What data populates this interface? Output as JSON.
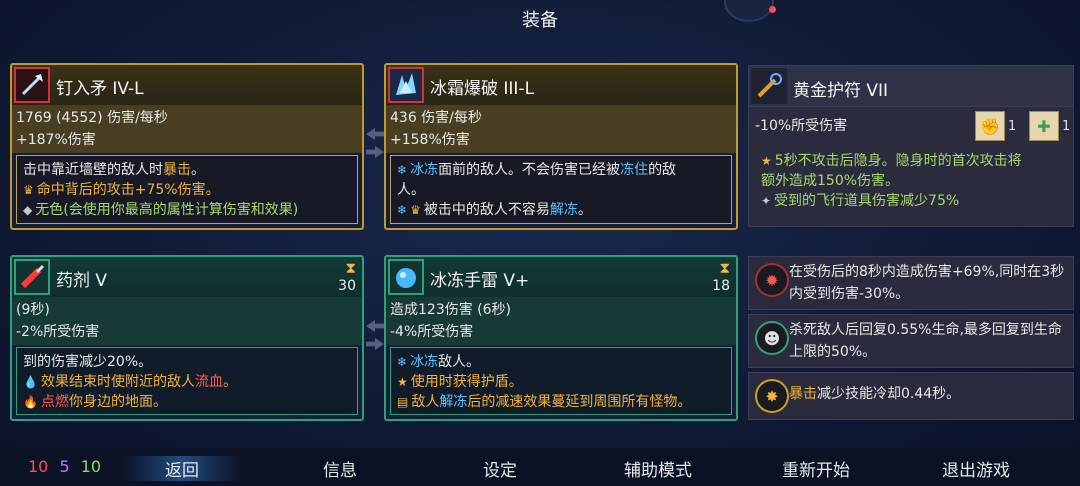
{
  "title": "装备",
  "weapons": [
    {
      "name": "钉入矛 IV-L",
      "stat1": "1769 (4552) 伤害/每秒",
      "stat2": "+187%伤害",
      "desc_line1_pre": "击中靠近墙壁的敌人时",
      "desc_line1_hl": "暴击",
      "desc_line1_post": "。",
      "desc_line2": "命中背后的攻击+75%伤害。",
      "desc_line3": "无色(会使用你最高的属性计算伤害和效果)"
    },
    {
      "name": "冰霜爆破 III-L",
      "stat1": "436 伤害/每秒",
      "stat2": "+158%伤害",
      "desc_line1_a": "冰冻",
      "desc_line1_b": "面前的敌人。不会伤害已经被",
      "desc_line1_c": "冻住",
      "desc_line1_d": "的敌",
      "desc_line2": "人。",
      "desc_line3_a": "被击中的敌人不容易",
      "desc_line3_b": "解冻",
      "desc_line3_c": "。"
    }
  ],
  "amulet": {
    "name": "黄金护符 VII",
    "stat": "-10%所受伤害",
    "scroll1_count": "1",
    "scroll2_count": "1",
    "desc_line1": "5秒不攻击后隐身。隐身时的首次攻击将",
    "desc_line2": "额外造成150%伤害。",
    "desc_line3": "受到的飞行道具伤害减少75%"
  },
  "skills": [
    {
      "name": "药剂 V",
      "cooldown": "30",
      "stat1": "(9秒)",
      "stat2": "-2%所受伤害",
      "desc_line1": "到的伤害减少20%。",
      "desc_line2_a": "效果结束时使附近的敌人",
      "desc_line2_b": "流血",
      "desc_line2_c": "。",
      "desc_line3_a": "点燃",
      "desc_line3_b": "你身边的地面。"
    },
    {
      "name": "冰冻手雷 V+",
      "cooldown": "18",
      "stat1": "造成123伤害 (6秒)",
      "stat2": "-4%所受伤害",
      "desc_line1_a": "冰冻",
      "desc_line1_b": "敌人。",
      "desc_line2": "使用时获得护盾。",
      "desc_line3_a": "敌人",
      "desc_line3_b": "解冻",
      "desc_line3_c": "后的减速效果蔓延到周围所有怪物。"
    }
  ],
  "mutations": [
    {
      "text": "在受伤后的8秒内造成伤害+69%,同时在3秒内受到伤害-30%。"
    },
    {
      "text": "杀死敌人后回复0.55%生命,最多回复到生命上限的50%。"
    },
    {
      "text_hl": "暴击",
      "text": "减少技能冷却0.44秒。"
    }
  ],
  "cells": {
    "red": "10",
    "purple": "5",
    "green": "10"
  },
  "nav": [
    "返回",
    "信息",
    "设定",
    "辅助模式",
    "重新开始",
    "退出游戏"
  ],
  "colors": {
    "gold_border": "#c29a2c",
    "green_border": "#2fa07b",
    "brutality": "#ff5a4a",
    "tactics": "#a070ff",
    "survival": "#7ad85a"
  }
}
